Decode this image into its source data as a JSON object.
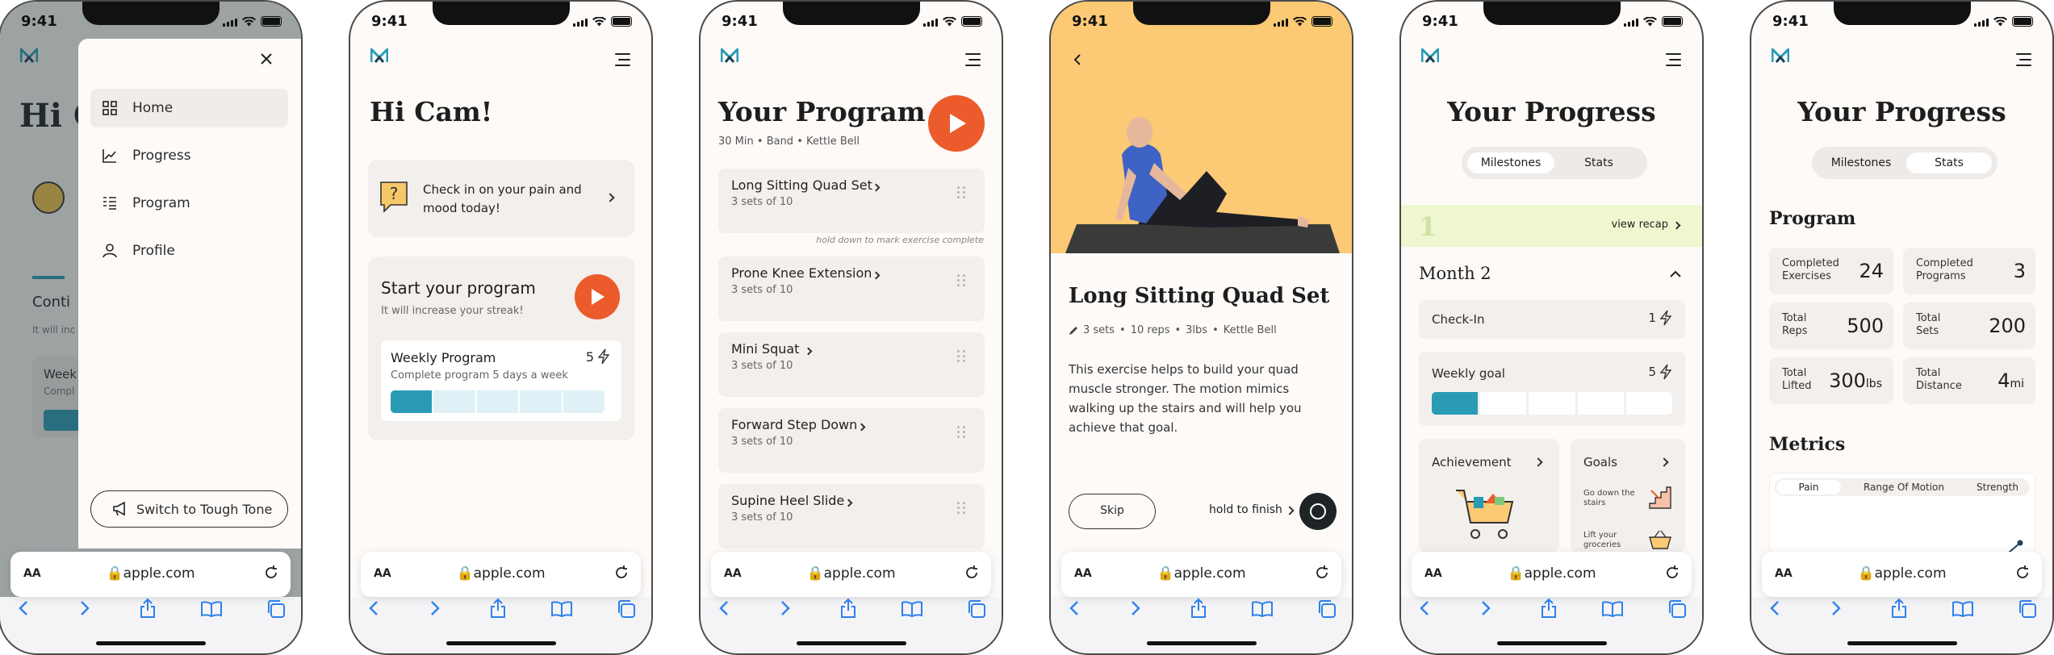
{
  "status_time": "9:41",
  "browser": {
    "url": "apple.com",
    "aa": "AA"
  },
  "screen1": {
    "greeting_partial": "Hi C",
    "behind_partial_1": "Conti",
    "behind_partial_2": "It will inc",
    "behind_partial_3": "Week",
    "behind_partial_4": "Compl",
    "menu_items": [
      {
        "label": "Home",
        "icon": "home-grid-icon"
      },
      {
        "label": "Progress",
        "icon": "line-chart-icon"
      },
      {
        "label": "Program",
        "icon": "list-icon"
      },
      {
        "label": "Profile",
        "icon": "person-icon"
      }
    ],
    "switch_label": "Switch to Tough Tone",
    "close_icon": "close-icon"
  },
  "screen2": {
    "greeting": "Hi Cam!",
    "checkin_text": "Check in on your pain and mood today!",
    "start_title": "Start your program",
    "start_subtitle": "It will increase your streak!",
    "weekly_title": "Weekly Program",
    "weekly_count": "5",
    "weekly_subtitle": "Complete program 5 days a week",
    "weekly_progress": 0.2
  },
  "screen3": {
    "title": "Your Program",
    "meta": [
      "30 Min",
      "Band",
      "Kettle Bell"
    ],
    "hint": "hold down to mark exercise complete",
    "exercises": [
      {
        "name": "Long Sitting Quad Set",
        "sets": "3 sets of 10"
      },
      {
        "name": "Prone Knee Extension",
        "sets": "3 sets of 10"
      },
      {
        "name": "Mini Squat",
        "sets": "3 sets of 10"
      },
      {
        "name": "Forward Step Down",
        "sets": "3 sets of 10"
      },
      {
        "name": "Supine Heel Slide",
        "sets": "3 sets of 10"
      }
    ]
  },
  "screen4": {
    "title": "Long Sitting Quad Set",
    "meta": [
      "3 sets",
      "10 reps",
      "3lbs",
      "Kettle Bell"
    ],
    "description": "This exercise helps to build your quad muscle stronger. The motion mimics walking up the stairs and will help you achieve that goal.",
    "skip_label": "Skip",
    "hold_label": "hold to finish",
    "hero_color": "#fcc975"
  },
  "screen5": {
    "title": "Your Progress",
    "tabs": [
      "Milestones",
      "Stats"
    ],
    "active_tab": "Milestones",
    "recap_number": "1",
    "recap_link": "view recap",
    "month_title": "Month 2",
    "checkin_label": "Check-In",
    "checkin_count": "1",
    "weekly_label": "Weekly goal",
    "weekly_count": "5",
    "weekly_progress": 0.2,
    "achievement_label": "Achievement",
    "goals_label": "Goals",
    "goal_items": [
      "Go down the stairs",
      "Lift your groceries"
    ]
  },
  "screen6": {
    "title": "Your Progress",
    "tabs": [
      "Milestones",
      "Stats"
    ],
    "active_tab": "Stats",
    "program_heading": "Program",
    "stats": [
      {
        "label": "Completed Exercises",
        "value": "24",
        "unit": ""
      },
      {
        "label": "Completed Programs",
        "value": "3",
        "unit": ""
      },
      {
        "label": "Total Reps",
        "value": "500",
        "unit": ""
      },
      {
        "label": "Total Sets",
        "value": "200",
        "unit": ""
      },
      {
        "label": "Total Lifted",
        "value": "300",
        "unit": "lbs"
      },
      {
        "label": "Total Distance",
        "value": "4",
        "unit": "mi"
      }
    ],
    "metrics_heading": "Metrics",
    "metric_tabs": [
      "Pain",
      "Range Of Motion",
      "Strength"
    ],
    "active_metric": "Pain"
  },
  "colors": {
    "accent_orange": "#ec5b2c",
    "teal": "#2a9bb5",
    "light_teal": "#dff1f6",
    "lime": "#eef7cf",
    "cream": "#fdfaf8",
    "card": "#f3efec"
  }
}
